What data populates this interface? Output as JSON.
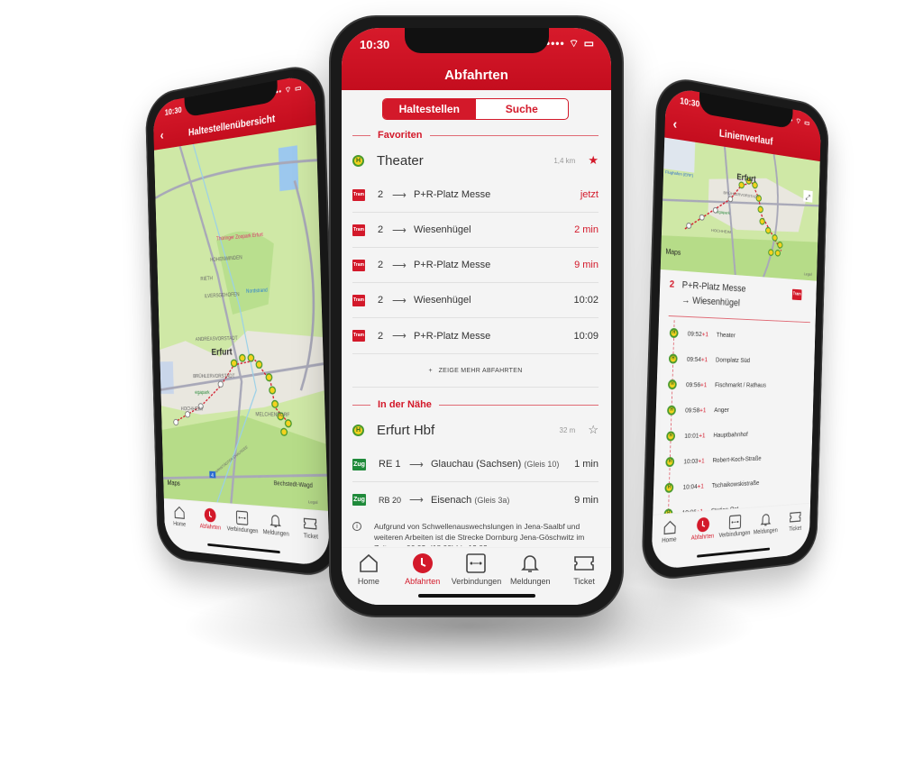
{
  "colors": {
    "brand_red": "#d3192a",
    "stop_yellow": "#f4d21e",
    "stop_green": "#4a9a2e",
    "train_green": "#1f8a3a"
  },
  "status": {
    "time": "10:30",
    "icons": "•••• ⌔ ▭"
  },
  "tabs": [
    {
      "label": "Home",
      "icon": "home-icon"
    },
    {
      "label": "Abfahrten",
      "icon": "clock-icon",
      "active": true
    },
    {
      "label": "Verbindungen",
      "icon": "connections-icon"
    },
    {
      "label": "Meldungen",
      "icon": "bell-icon"
    },
    {
      "label": "Ticket",
      "icon": "ticket-icon"
    }
  ],
  "center": {
    "title": "Abfahrten",
    "segments": [
      "Haltestellen",
      "Suche"
    ],
    "active_segment": "Haltestellen",
    "favorites": {
      "heading": "Favoriten",
      "stop": {
        "name": "Theater",
        "distance": "1,4 km",
        "favorite": true,
        "icon": "H"
      },
      "departures": [
        {
          "mode": "Tram",
          "line": "2",
          "destination": "P+R-Platz Messe",
          "time": "jetzt",
          "realtime": true
        },
        {
          "mode": "Tram",
          "line": "2",
          "destination": "Wiesenhügel",
          "time": "2 min",
          "realtime": true
        },
        {
          "mode": "Tram",
          "line": "2",
          "destination": "P+R-Platz Messe",
          "time": "9 min",
          "realtime": true
        },
        {
          "mode": "Tram",
          "line": "2",
          "destination": "Wiesenhügel",
          "time": "10:02",
          "realtime": false
        },
        {
          "mode": "Tram",
          "line": "2",
          "destination": "P+R-Platz Messe",
          "time": "10:09",
          "realtime": false
        }
      ],
      "show_more": "ZEIGE MEHR ABFAHRTEN"
    },
    "nearby": {
      "heading": "In der Nähe",
      "stop": {
        "name": "Erfurt Hbf",
        "distance": "32 m",
        "favorite": false,
        "icon": "H"
      },
      "departures": [
        {
          "mode": "Zug",
          "line": "RE 1",
          "destination": "Glauchau (Sachsen)",
          "platform": "(Gleis 10)",
          "time": "1 min"
        },
        {
          "mode": "Zug",
          "line": "RB 20",
          "destination": "Eisenach",
          "platform": "(Gleis 3a)",
          "time": "9 min"
        }
      ],
      "notice": "Aufgrund von Schwellenauswechslungen in Jena-Saalbf und weiteren Arbeiten ist die Strecke Dornburg  Jena-Göschwitz im Zeitraum 06.03. (18:00) bis 13.03."
    }
  },
  "left": {
    "title": "Haltestellenübersicht",
    "map": {
      "labels": [
        "Thüringer Zoopark Erfurt",
        "HOHENWINDEN",
        "RIETH",
        "ILVERSGEHOFEN",
        "Nordstrand",
        "ANDREASVORSTADT",
        "Erfurt",
        "BRÜHLERVORSTADT",
        "egapark",
        "HOCHHEIM",
        "MELCHENDORF",
        "ARNSTÄDTER CHAUSSEE",
        "Bechstedt-Wagd",
        "4"
      ],
      "attribution": "Maps",
      "legal": "Legal"
    }
  },
  "right": {
    "title": "Linienverlauf",
    "map": {
      "labels": [
        "Erfurt",
        "BRÜHLERVORSTADT",
        "egapark",
        "HOCHHEIM",
        "Flughafen (ERF)"
      ],
      "attribution": "Maps",
      "legal": "Legal"
    },
    "route": {
      "line": "2",
      "from": "P+R-Platz Messe",
      "to": "→ Wiesenhügel",
      "mode": "Tram"
    },
    "stops": [
      {
        "time": "09:52",
        "delay": "+1",
        "name": "Theater"
      },
      {
        "time": "09:54",
        "delay": "+1",
        "name": "Domplatz Süd"
      },
      {
        "time": "09:56",
        "delay": "+1",
        "name": "Fischmarkt / Rathaus"
      },
      {
        "time": "09:58",
        "delay": "+1",
        "name": "Anger"
      },
      {
        "time": "10:01",
        "delay": "+1",
        "name": "Hauptbahnhof"
      },
      {
        "time": "10:03",
        "delay": "+1",
        "name": "Robert-Koch-Straße"
      },
      {
        "time": "10:04",
        "delay": "+1",
        "name": "Tschaikowskistraße"
      },
      {
        "time": "10:06",
        "delay": "+1",
        "name": "Station Ost"
      }
    ]
  }
}
